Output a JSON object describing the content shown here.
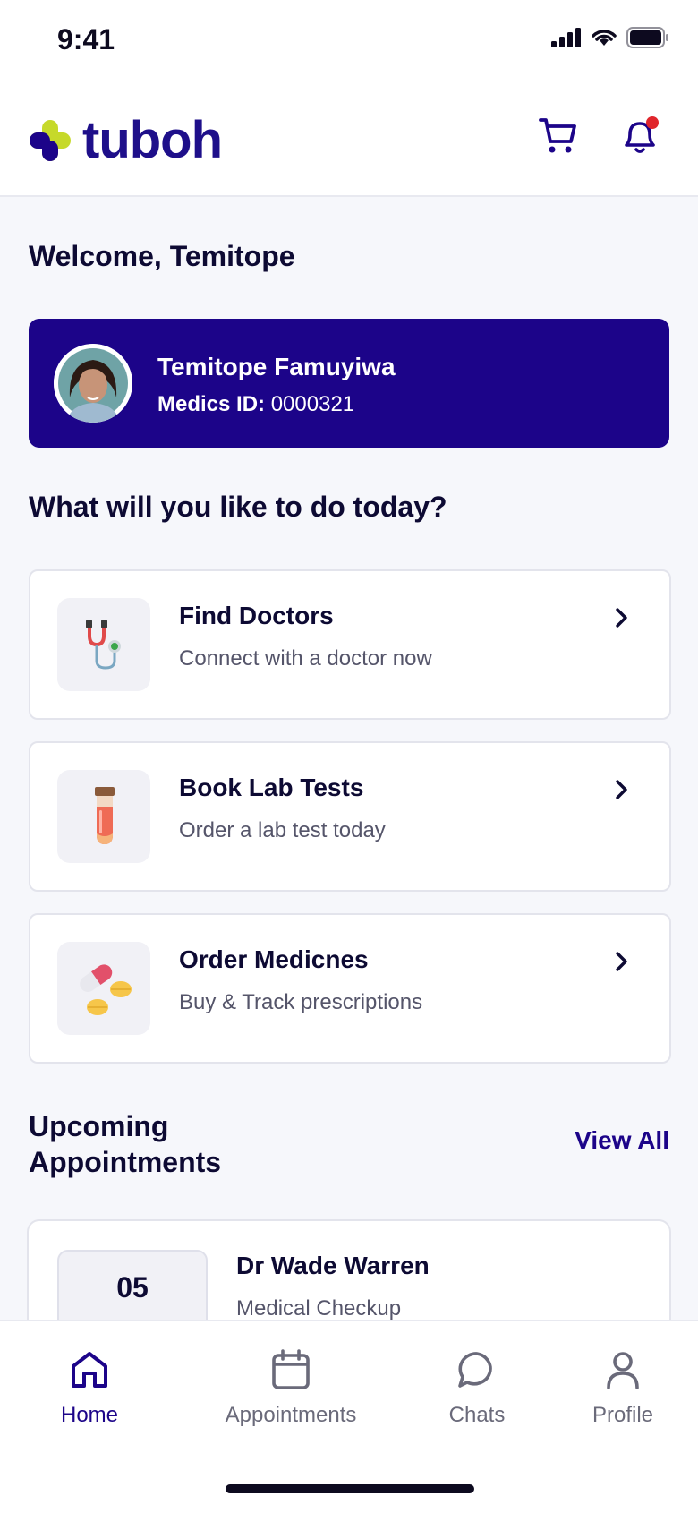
{
  "status_bar": {
    "time": "9:41"
  },
  "header": {
    "logo_text": "tuboh",
    "brand_color": "#1c0489",
    "logo_accent": "#c6d92a",
    "notification_dot_color": "#e0262c"
  },
  "welcome": {
    "text": "Welcome, Temitope"
  },
  "profile": {
    "name": "Temitope Famuyiwa",
    "id_label": "Medics ID:",
    "id_value": "0000321"
  },
  "question": "What will you like to do today?",
  "actions": [
    {
      "title": "Find Doctors",
      "subtitle": "Connect with a doctor now",
      "icon": "stethoscope-icon"
    },
    {
      "title": "Book Lab Tests",
      "subtitle": "Order a lab test today",
      "icon": "test-tube-icon"
    },
    {
      "title": "Order Medicnes",
      "subtitle": "Buy & Track prescriptions",
      "icon": "pills-icon"
    }
  ],
  "upcoming": {
    "title_line1": "Upcoming",
    "title_line2": "Appointments",
    "view_all": "View All",
    "appointment": {
      "day": "05",
      "doctor": "Dr Wade Warren",
      "type": "Medical Checkup"
    }
  },
  "tabbar": {
    "tabs": [
      {
        "label": "Home",
        "icon": "home-icon",
        "active": true
      },
      {
        "label": "Appointments",
        "icon": "calendar-icon",
        "active": false
      },
      {
        "label": "Chats",
        "icon": "chat-icon",
        "active": false
      },
      {
        "label": "Profile",
        "icon": "person-icon",
        "active": false
      }
    ]
  }
}
